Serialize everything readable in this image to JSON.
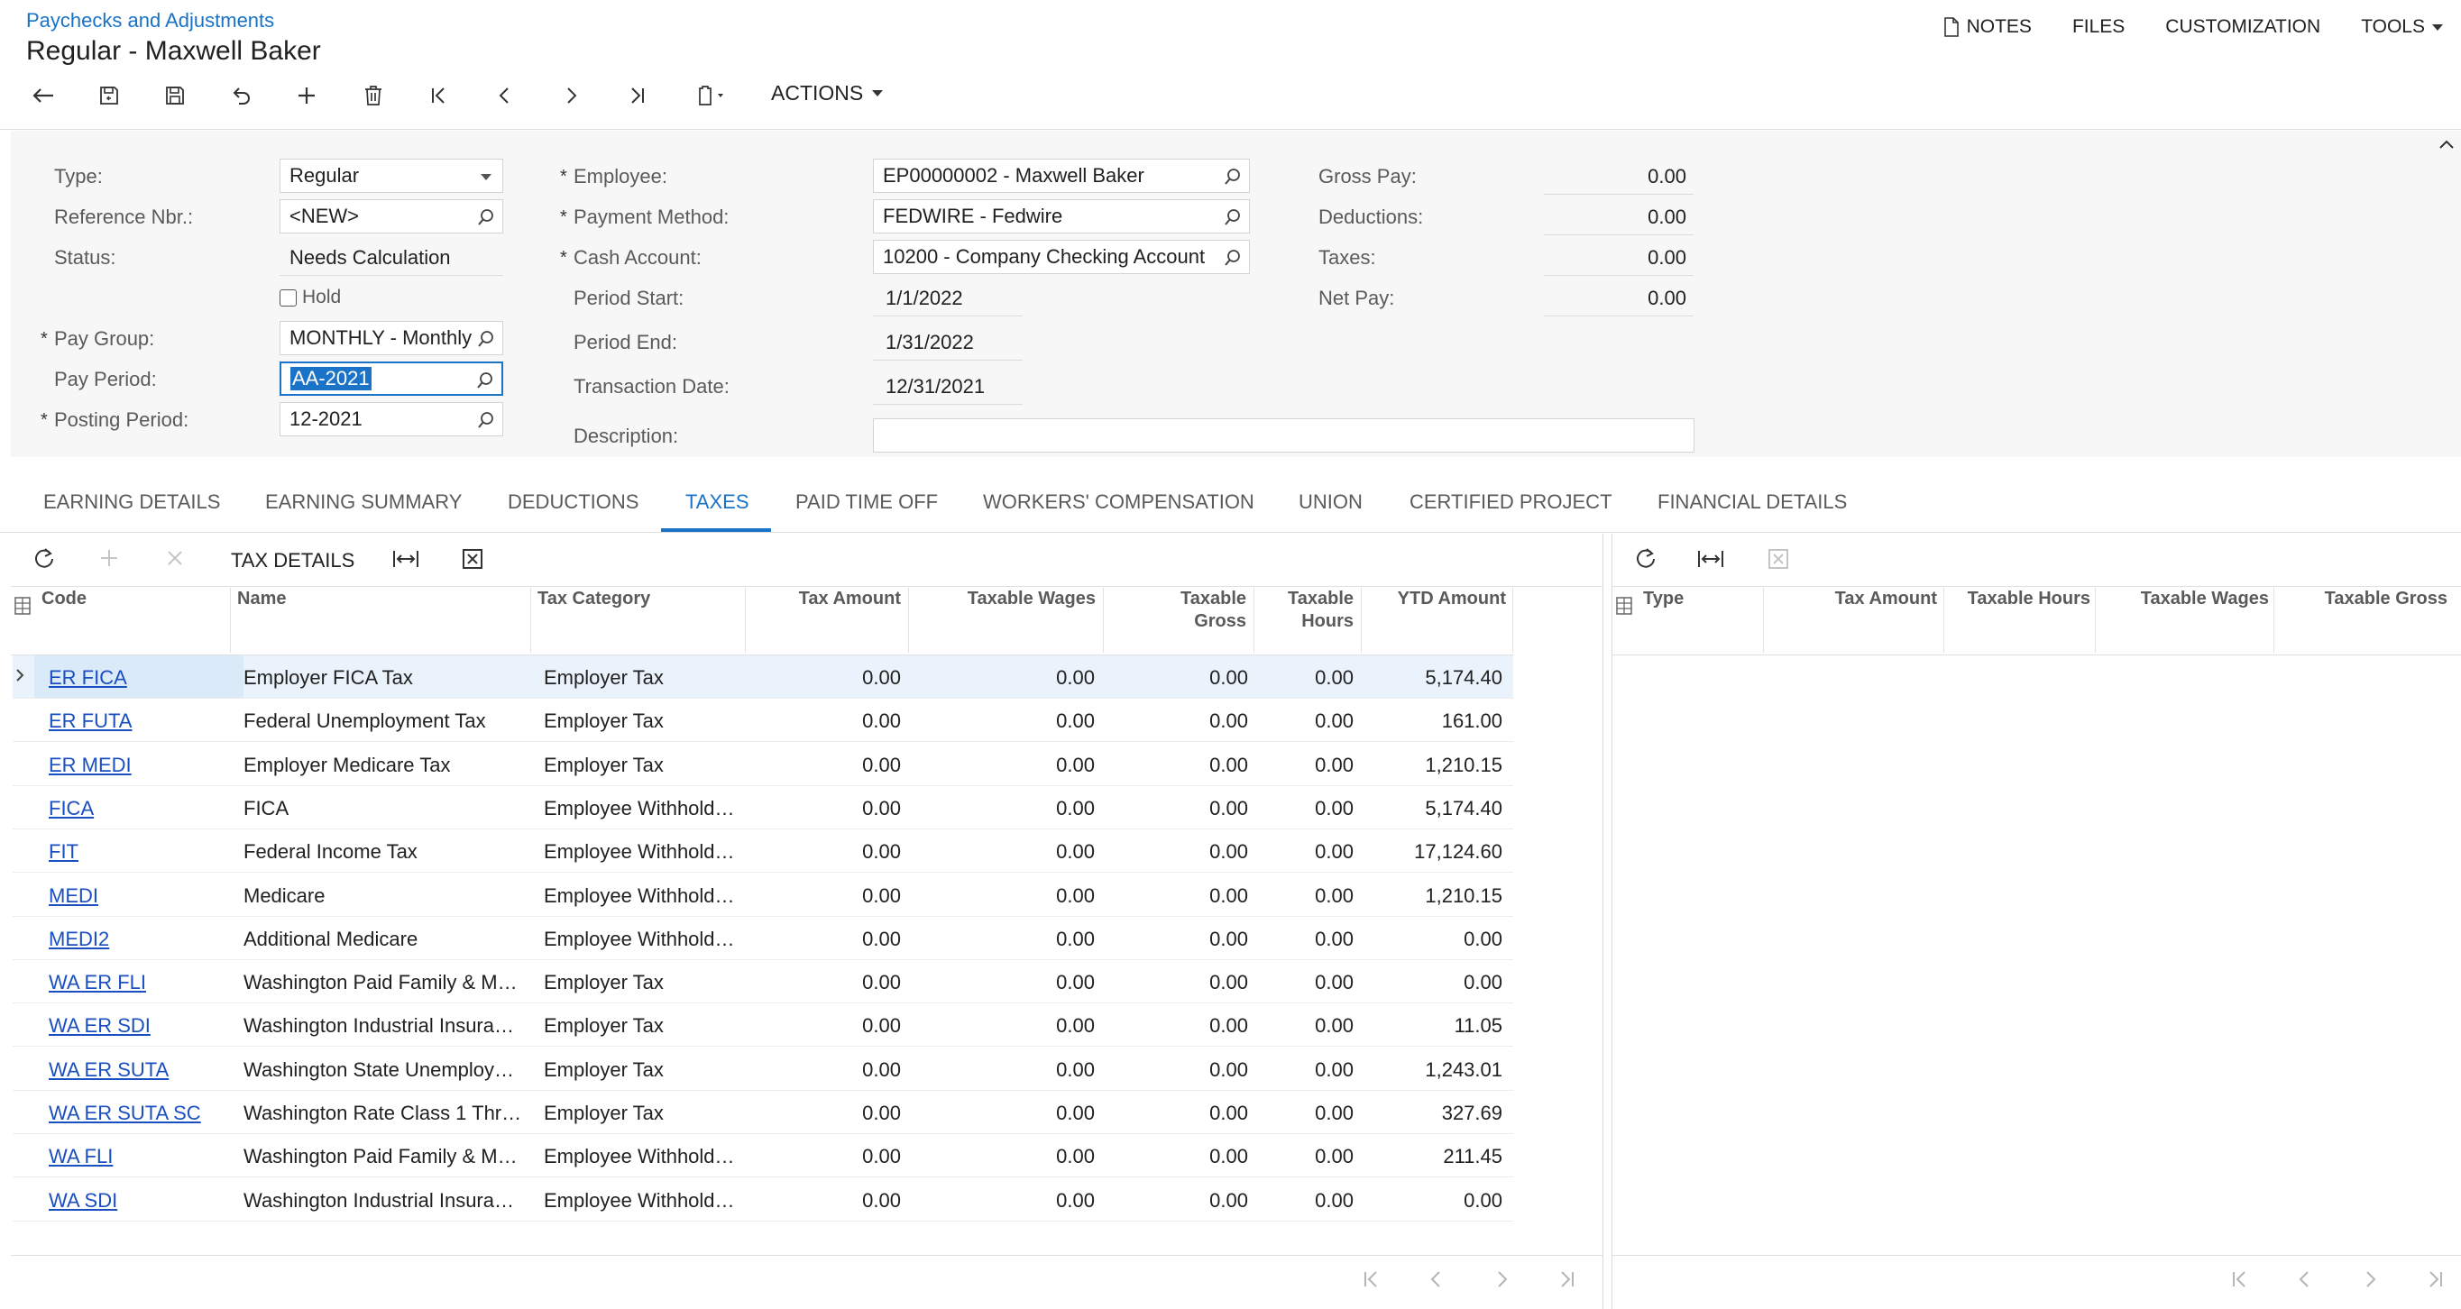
{
  "header": {
    "breadcrumb": "Paychecks and Adjustments",
    "title": "Regular - Maxwell Baker",
    "links": {
      "notes": "NOTES",
      "files": "FILES",
      "customization": "CUSTOMIZATION",
      "tools": "TOOLS"
    },
    "actions_label": "ACTIONS"
  },
  "form": {
    "type": {
      "label": "Type:",
      "value": "Regular"
    },
    "reference": {
      "label": "Reference Nbr.:",
      "value": "<NEW>"
    },
    "status": {
      "label": "Status:",
      "value": "Needs Calculation"
    },
    "hold": {
      "label": "Hold",
      "checked": false
    },
    "pay_group": {
      "label": "Pay Group:",
      "value": "MONTHLY - Monthly"
    },
    "pay_period": {
      "label": "Pay Period:",
      "value": "AA-2021"
    },
    "posting_period": {
      "label": "Posting Period:",
      "value": "12-2021"
    },
    "employee": {
      "label": "Employee:",
      "value": "EP00000002 - Maxwell Baker"
    },
    "payment_method": {
      "label": "Payment Method:",
      "value": "FEDWIRE - Fedwire"
    },
    "cash_account": {
      "label": "Cash Account:",
      "value": "10200 - Company Checking Account"
    },
    "period_start": {
      "label": "Period Start:",
      "value": "1/1/2022"
    },
    "period_end": {
      "label": "Period End:",
      "value": "1/31/2022"
    },
    "transaction_date": {
      "label": "Transaction Date:",
      "value": "12/31/2021"
    },
    "description": {
      "label": "Description:",
      "value": ""
    },
    "gross_pay": {
      "label": "Gross Pay:",
      "value": "0.00"
    },
    "deductions": {
      "label": "Deductions:",
      "value": "0.00"
    },
    "taxes": {
      "label": "Taxes:",
      "value": "0.00"
    },
    "net_pay": {
      "label": "Net Pay:",
      "value": "0.00"
    }
  },
  "tabs": [
    "EARNING DETAILS",
    "EARNING SUMMARY",
    "DEDUCTIONS",
    "TAXES",
    "PAID TIME OFF",
    "WORKERS' COMPENSATION",
    "UNION",
    "CERTIFIED PROJECT",
    "FINANCIAL DETAILS"
  ],
  "active_tab": "TAXES",
  "tax_grid": {
    "toolbar_label": "TAX DETAILS",
    "columns": [
      "Code",
      "Name",
      "Tax Category",
      "Tax Amount",
      "Taxable Wages",
      "Taxable Gross",
      "Taxable Hours",
      "YTD Amount"
    ],
    "rows": [
      [
        "ER FICA",
        "Employer FICA Tax",
        "Employer Tax",
        "0.00",
        "0.00",
        "0.00",
        "0.00",
        "5,174.40"
      ],
      [
        "ER FUTA",
        "Federal Unemployment Tax",
        "Employer Tax",
        "0.00",
        "0.00",
        "0.00",
        "0.00",
        "161.00"
      ],
      [
        "ER MEDI",
        "Employer Medicare Tax",
        "Employer Tax",
        "0.00",
        "0.00",
        "0.00",
        "0.00",
        "1,210.15"
      ],
      [
        "FICA",
        "FICA",
        "Employee Withhold…",
        "0.00",
        "0.00",
        "0.00",
        "0.00",
        "5,174.40"
      ],
      [
        "FIT",
        "Federal Income Tax",
        "Employee Withhold…",
        "0.00",
        "0.00",
        "0.00",
        "0.00",
        "17,124.60"
      ],
      [
        "MEDI",
        "Medicare",
        "Employee Withhold…",
        "0.00",
        "0.00",
        "0.00",
        "0.00",
        "1,210.15"
      ],
      [
        "MEDI2",
        "Additional Medicare",
        "Employee Withhold…",
        "0.00",
        "0.00",
        "0.00",
        "0.00",
        "0.00"
      ],
      [
        "WA ER FLI",
        "Washington Paid Family & M…",
        "Employer Tax",
        "0.00",
        "0.00",
        "0.00",
        "0.00",
        "0.00"
      ],
      [
        "WA ER SDI",
        "Washington Industrial Insura…",
        "Employer Tax",
        "0.00",
        "0.00",
        "0.00",
        "0.00",
        "11.05"
      ],
      [
        "WA ER SUTA",
        "Washington State Unemploy…",
        "Employer Tax",
        "0.00",
        "0.00",
        "0.00",
        "0.00",
        "1,243.01"
      ],
      [
        "WA ER SUTA SC",
        "Washington Rate Class 1 Thr…",
        "Employer Tax",
        "0.00",
        "0.00",
        "0.00",
        "0.00",
        "327.69"
      ],
      [
        "WA FLI",
        "Washington Paid Family & M…",
        "Employee Withhold…",
        "0.00",
        "0.00",
        "0.00",
        "0.00",
        "211.45"
      ],
      [
        "WA SDI",
        "Washington Industrial Insura…",
        "Employee Withhold…",
        "0.00",
        "0.00",
        "0.00",
        "0.00",
        "0.00"
      ]
    ]
  },
  "detail_grid": {
    "columns": [
      "Type",
      "Tax Amount",
      "Taxable Hours",
      "Taxable Wages",
      "Taxable Gross"
    ]
  },
  "colors": {
    "accent": "#1a73c7",
    "link": "#1a4fc0",
    "selected_row": "#eaf3fc"
  }
}
